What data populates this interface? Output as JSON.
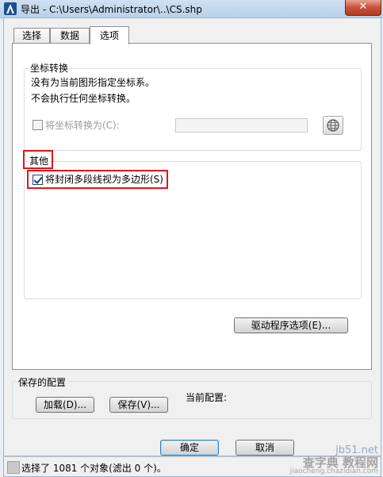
{
  "window": {
    "title": "导出 - C:\\Users\\Administrator\\..\\CS.shp",
    "close_label": "✕"
  },
  "tabs": [
    {
      "label": "选择"
    },
    {
      "label": "数据"
    },
    {
      "label": "选项"
    }
  ],
  "coord": {
    "group_label": "坐标转换",
    "line1": "没有为当前图形指定坐标系。",
    "line2": "不会执行任何坐标转换。",
    "checkbox_label": "将坐标转换为(C):",
    "value": ""
  },
  "other": {
    "group_label": "其他",
    "checkbox_label": "将封闭多段线视为多边形(S)",
    "checked": true
  },
  "driver_button": "驱动程序选项(E)...",
  "saved": {
    "group_label": "保存的配置",
    "load_button": "加载(D)...",
    "save_button": "保存(V)...",
    "current_label": "当前配置:"
  },
  "ok_button": "确定",
  "cancel_button": "取消",
  "status": {
    "text": "选择了 1081 个对象(滤出 0 个)。"
  },
  "watermark": {
    "line1": "jb51.net",
    "line2": "查字典 教程网",
    "line3": "jiaocheng.chazidian.com"
  },
  "colors": {
    "highlight": "#e0161b",
    "titlebar": "#b9d1ea"
  }
}
